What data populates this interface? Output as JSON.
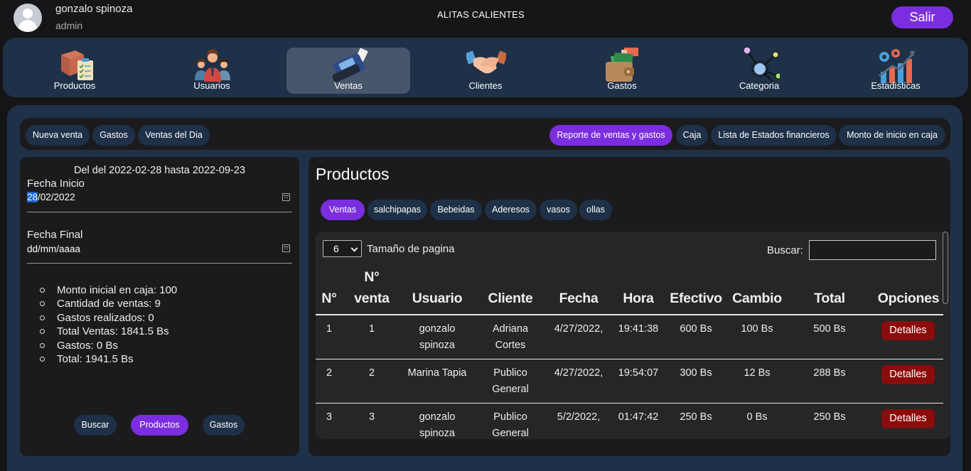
{
  "header": {
    "user_name": "gonzalo spinoza",
    "user_role": "admin",
    "app_title": "ALITAS CALIENTES",
    "logout_label": "Salir"
  },
  "nav": {
    "items": [
      {
        "label": "Productos",
        "icon": "box-clipboard-icon"
      },
      {
        "label": "Usuarios",
        "icon": "users-group-icon"
      },
      {
        "label": "Ventas",
        "icon": "card-terminal-icon",
        "active": true
      },
      {
        "label": "Clientes",
        "icon": "handshake-icon"
      },
      {
        "label": "Gastos",
        "icon": "wallet-money-icon"
      },
      {
        "label": "Categoria",
        "icon": "network-nodes-icon"
      },
      {
        "label": "Estadisticas",
        "icon": "stats-chart-icon"
      }
    ]
  },
  "toolbar": {
    "left": [
      "Nueva venta",
      "Gastos",
      "Ventas del Dia"
    ],
    "right": [
      "Reporte de ventas y gastos",
      "Caja",
      "Lista de Estados financieros",
      "Monto de inicio en caja"
    ]
  },
  "report": {
    "range_text": "Del del 2022-02-28 hasta 2022-09-23",
    "start_label": "Fecha Inicio",
    "start_value_day": "28",
    "start_value_rest": "/02/2022",
    "end_label": "Fecha Final",
    "end_placeholder": "dd/mm/aaaa",
    "summary": [
      "Monto inicial en caja: 100",
      "Cantidad de ventas: 9",
      "Gastos realizados: 0",
      "Total Ventas: 1841.5 Bs",
      "Gastos: 0 Bs",
      "Total: 1941.5 Bs"
    ],
    "buttons": [
      "Buscar",
      "Productos",
      "Gastos"
    ]
  },
  "products": {
    "title": "Productos",
    "category_tabs": [
      "Ventas",
      "salchipapas",
      "Bebeidas",
      "Aderesos",
      "vasos",
      "ollas"
    ],
    "page_size": "6",
    "page_size_label": "Tamaño de pagina",
    "search_label": "Buscar:",
    "search_value": "",
    "columns": {
      "idx": "N°",
      "venta_1": "N°",
      "venta_2": "venta",
      "usuario": "Usuario",
      "cliente": "Cliente",
      "fecha": "Fecha",
      "hora": "Hora",
      "efectivo": "Efectivo",
      "cambio": "Cambio",
      "total": "Total",
      "opciones": "Opciones"
    },
    "details_label": "Detalles",
    "rows": [
      {
        "idx": "1",
        "venta": "1",
        "usuario_1": "gonzalo",
        "usuario_2": "spinoza",
        "cliente_1": "Adriana",
        "cliente_2": "Cortes",
        "fecha": "4/27/2022,",
        "hora": "19:41:38",
        "efectivo": "600 Bs",
        "cambio": "100 Bs",
        "total": "500 Bs"
      },
      {
        "idx": "2",
        "venta": "2",
        "usuario_1": "Marina Tapia",
        "usuario_2": "",
        "cliente_1": "Publico",
        "cliente_2": "General",
        "fecha": "4/27/2022,",
        "hora": "19:54:07",
        "efectivo": "300 Bs",
        "cambio": "12 Bs",
        "total": "288 Bs"
      },
      {
        "idx": "3",
        "venta": "3",
        "usuario_1": "gonzalo",
        "usuario_2": "spinoza",
        "cliente_1": "Publico",
        "cliente_2": "General",
        "fecha": "5/2/2022,",
        "hora": "01:47:42",
        "efectivo": "250 Bs",
        "cambio": "0 Bs",
        "total": "250 Bs"
      }
    ]
  },
  "colors": {
    "accent": "#7b2ee0",
    "panel": "#1e3148",
    "card": "#1b1b1d",
    "danger": "#8b0c0c"
  }
}
